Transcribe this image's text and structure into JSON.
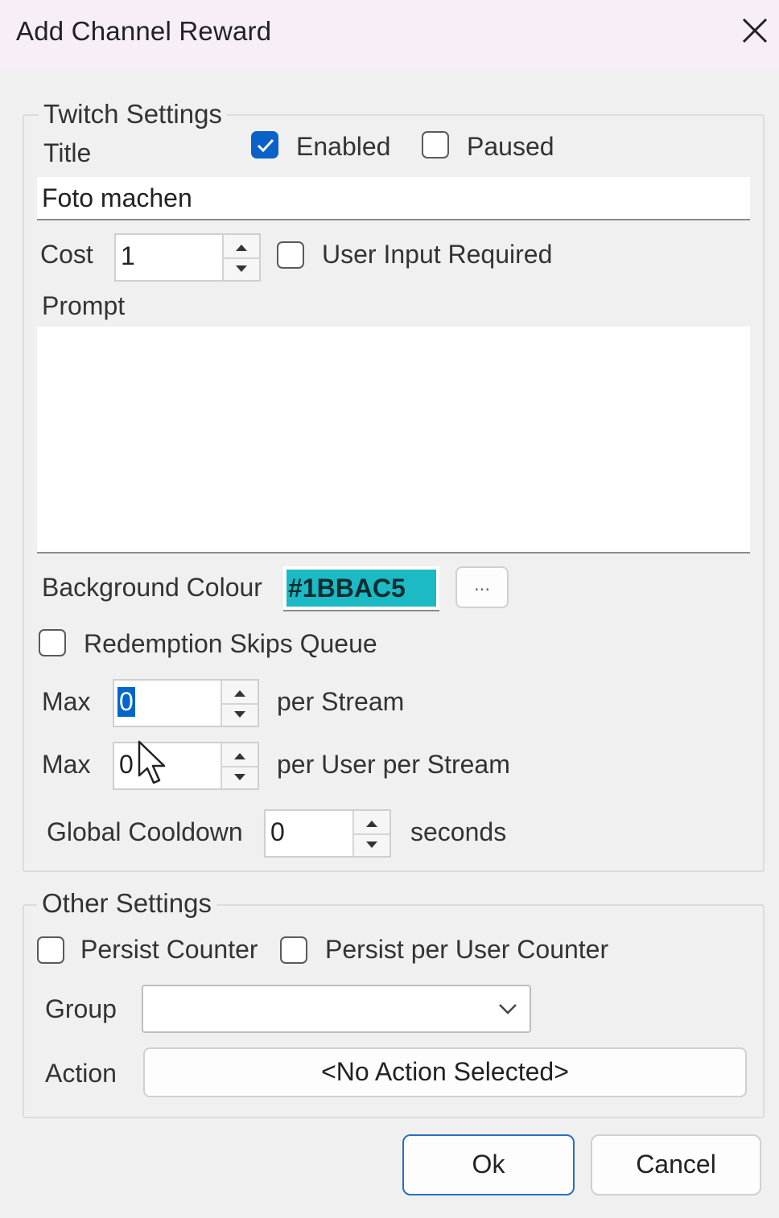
{
  "window": {
    "title": "Add Channel Reward"
  },
  "twitch_settings": {
    "legend": "Twitch Settings",
    "title_label": "Title",
    "enabled_label": "Enabled",
    "enabled_checked": true,
    "paused_label": "Paused",
    "paused_checked": false,
    "title_value": "Foto machen",
    "cost_label": "Cost",
    "cost_value": "1",
    "user_input_label": "User Input Required",
    "user_input_checked": false,
    "prompt_label": "Prompt",
    "prompt_value": "",
    "bg_colour_label": "Background Colour",
    "bg_colour_value": "#1BBAC5",
    "bg_colour_hex": "#1BBAC5",
    "browse_label": "...",
    "skips_queue_label": "Redemption Skips Queue",
    "skips_queue_checked": false,
    "max_label_1": "Max",
    "max_stream_value": "0",
    "per_stream_label": "per Stream",
    "max_label_2": "Max",
    "max_user_value": "0",
    "per_user_stream_label": "per User per Stream",
    "cooldown_label": "Global Cooldown",
    "cooldown_value": "0",
    "seconds_label": "seconds"
  },
  "other_settings": {
    "legend": "Other Settings",
    "persist_counter_label": "Persist Counter",
    "persist_counter_checked": false,
    "persist_user_counter_label": "Persist per User Counter",
    "persist_user_counter_checked": false,
    "group_label": "Group",
    "group_value": "",
    "action_label": "Action",
    "action_value": "<No Action Selected>"
  },
  "buttons": {
    "ok": "Ok",
    "cancel": "Cancel"
  },
  "colors": {
    "accent": "#0a62c9",
    "selection": "#0066cc"
  }
}
